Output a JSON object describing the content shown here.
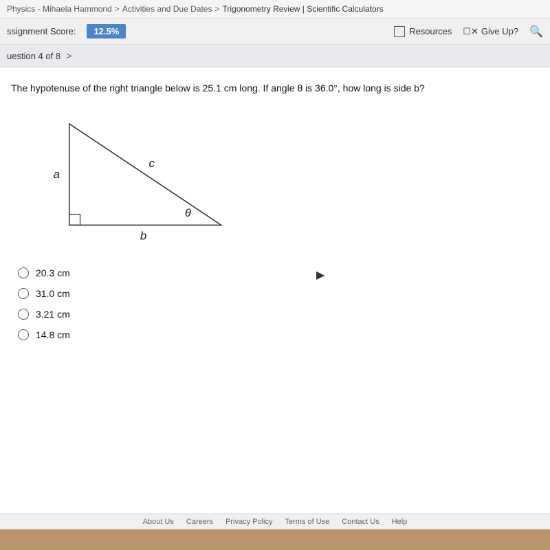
{
  "breadcrumb": {
    "part1": "Physics - Mihaela Hammond",
    "sep1": ">",
    "part2": "Activities and Due Dates",
    "sep2": ">",
    "part3": "Trigonometry Review | Scientific Calculators"
  },
  "header": {
    "assignment_score_label": "ssignment Score:",
    "score": "12.5%",
    "resources_label": "Resources",
    "give_up_label": "Give Up?"
  },
  "question_nav": {
    "label": "uestion 4 of 8"
  },
  "question": {
    "text": "The hypotenuse of the right triangle below is 25.1 cm long. If angle θ is 36.0°, how long is side b?",
    "triangle": {
      "side_a": "a",
      "side_b": "b",
      "side_c": "c",
      "angle": "θ"
    },
    "choices": [
      {
        "id": "A",
        "text": "20.3 cm"
      },
      {
        "id": "B",
        "text": "31.0 cm"
      },
      {
        "id": "C",
        "text": "3.21 cm"
      },
      {
        "id": "D",
        "text": "14.8 cm"
      }
    ]
  },
  "footer": {
    "links": [
      "About Us",
      "Careers",
      "Privacy Policy",
      "Terms of Use",
      "Contact Us",
      "Help"
    ]
  }
}
